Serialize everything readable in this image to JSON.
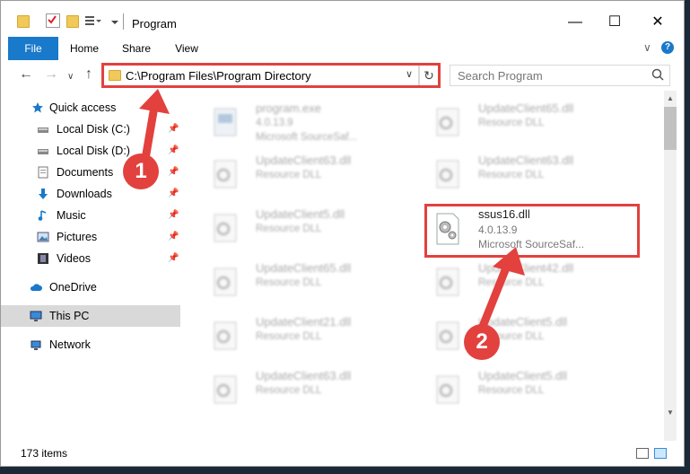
{
  "window": {
    "title": "Program"
  },
  "ribbon": {
    "tabs": [
      "File",
      "Home",
      "Share",
      "View"
    ]
  },
  "address": {
    "path": "C:\\Program Files\\Program Directory"
  },
  "search": {
    "placeholder": "Search Program"
  },
  "nav": {
    "items": [
      {
        "label": "Quick access",
        "icon": "star-icon"
      },
      {
        "label": "Local Disk (C:)",
        "icon": "drive-icon",
        "pinned": true
      },
      {
        "label": "Local Disk (D:)",
        "icon": "drive-icon",
        "pinned": true
      },
      {
        "label": "Documents",
        "icon": "documents-icon",
        "pinned": true
      },
      {
        "label": "Downloads",
        "icon": "downloads-icon",
        "pinned": true
      },
      {
        "label": "Music",
        "icon": "music-icon",
        "pinned": true
      },
      {
        "label": "Pictures",
        "icon": "pictures-icon",
        "pinned": true
      },
      {
        "label": "Videos",
        "icon": "videos-icon",
        "pinned": true
      },
      {
        "label": "OneDrive",
        "icon": "cloud-icon"
      },
      {
        "label": "This PC",
        "icon": "monitor-icon",
        "selected": true
      },
      {
        "label": "Network",
        "icon": "network-icon"
      }
    ]
  },
  "files": [
    {
      "name": "program.exe",
      "line2": "4.0.13.9",
      "line3": "Microsoft SourceSaf...",
      "blurred": true
    },
    {
      "name": "UpdateClient65.dll",
      "line2": "Resource DLL",
      "blurred": true
    },
    {
      "name": "UpdateClient63.dll",
      "line2": "Resource DLL",
      "blurred": true
    },
    {
      "name": "UpdateClient63.dll",
      "line2": "Resource DLL",
      "blurred": true
    },
    {
      "name": "UpdateClient5.dll",
      "line2": "Resource DLL",
      "blurred": true
    },
    {
      "name": "ssus16.dll",
      "line2": "4.0.13.9",
      "line3": "Microsoft SourceSaf...",
      "blurred": false
    },
    {
      "name": "UpdateClient65.dll",
      "line2": "Resource DLL",
      "blurred": true
    },
    {
      "name": "UpdateClient42.dll",
      "line2": "Resource DLL",
      "blurred": true
    },
    {
      "name": "UpdateClient21.dll",
      "line2": "Resource DLL",
      "blurred": true
    },
    {
      "name": "UpdateClient5.dll",
      "line2": "Resource DLL",
      "blurred": true
    },
    {
      "name": "UpdateClient63.dll",
      "line2": "Resource DLL",
      "blurred": true
    },
    {
      "name": "UpdateClient5.dll",
      "line2": "Resource DLL",
      "blurred": true
    }
  ],
  "status": {
    "items_count": "173 items"
  },
  "annotations": {
    "step1": "1",
    "step2": "2"
  },
  "colors": {
    "accent": "#1979ca",
    "highlight": "#e2413e",
    "folder": "#f0c95a"
  }
}
